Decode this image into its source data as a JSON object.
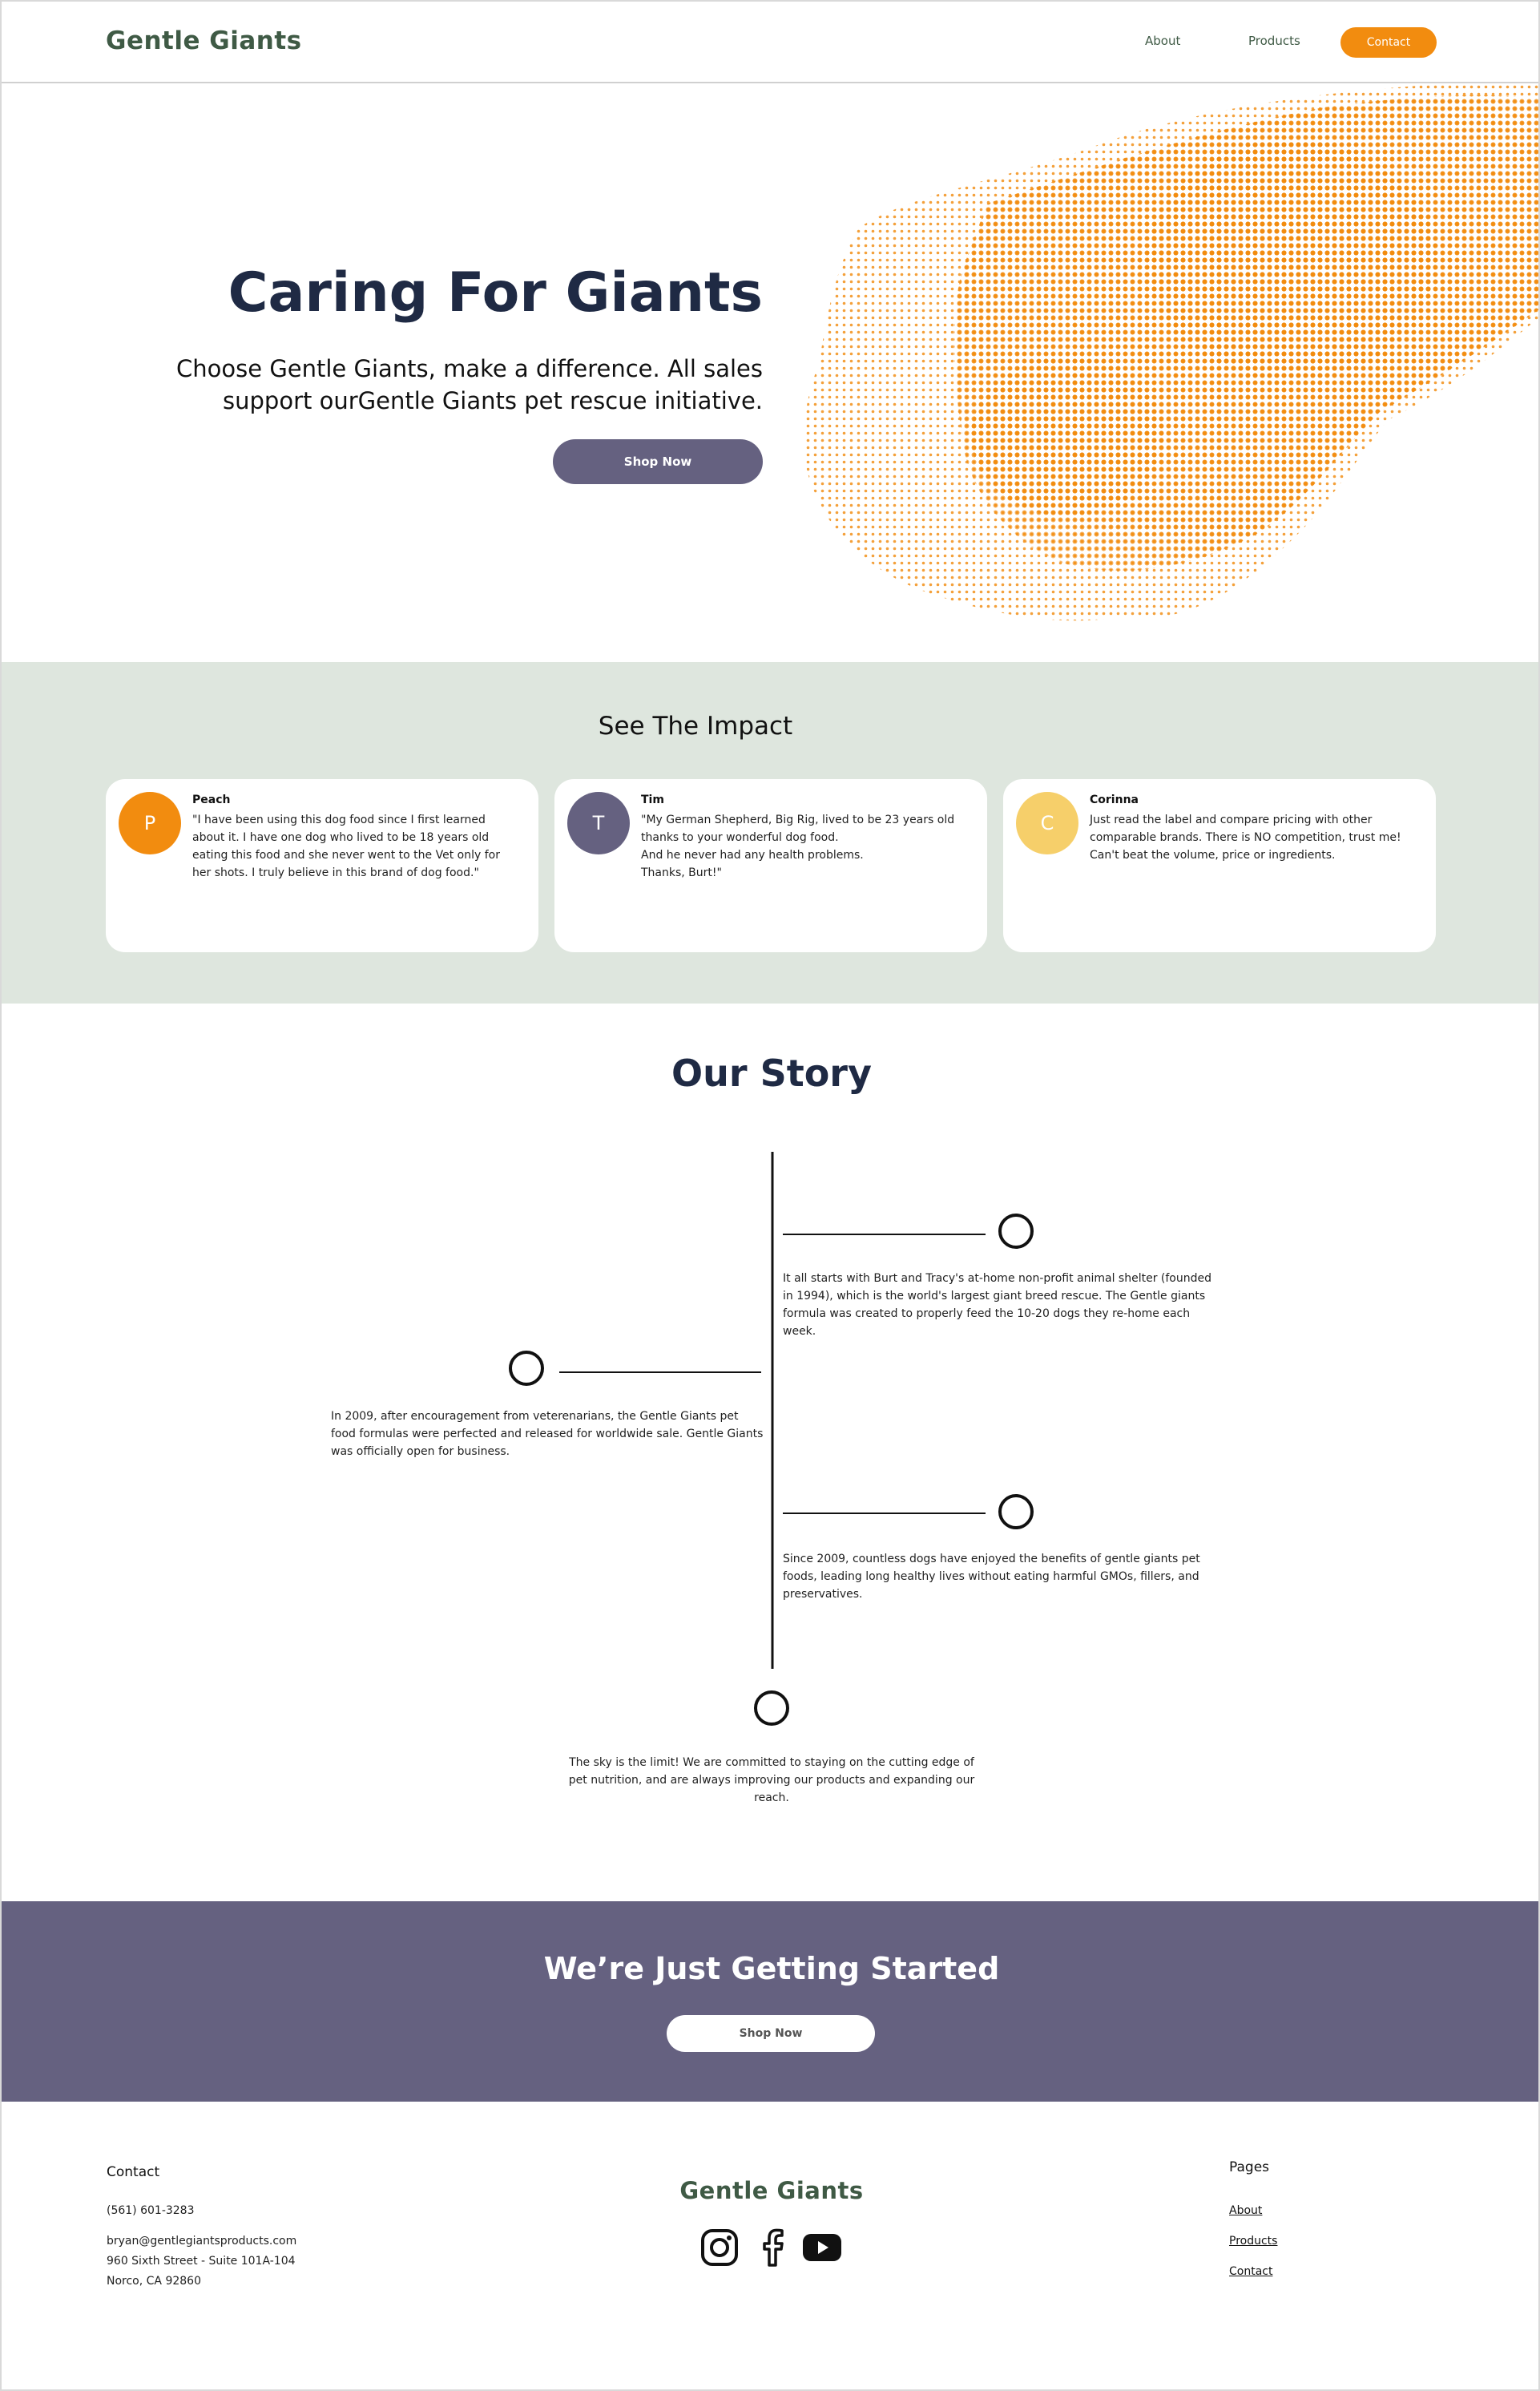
{
  "header": {
    "brand": "Gentle Giants",
    "nav": {
      "about": "About",
      "products": "Products",
      "contact": "Contact"
    }
  },
  "hero": {
    "title": "Caring For Giants",
    "subtitle": "Choose Gentle Giants, make a difference. All sales support ourGentle Giants pet rescue initiative.",
    "button": "Shop Now"
  },
  "impact": {
    "title": "See The Impact",
    "testimonials": [
      {
        "initial": "P",
        "name": "Peach",
        "color": "#f28c0f",
        "text": "\"I have been using this dog food since I first learned about it. I have one dog who lived to be 18 years old eating this food and she never went to the Vet only for her shots. I truly believe in this brand of dog food.\""
      },
      {
        "initial": "T",
        "name": "Tim",
        "color": "#656180",
        "text": "\"My German Shepherd, Big Rig, lived to be 23 years old thanks to your wonderful dog food.\nAnd he never had any health problems.\nThanks, Burt!\""
      },
      {
        "initial": "C",
        "name": "Corinna",
        "color": "#f6cf6a",
        "text": "Just read the label and compare pricing with other comparable brands. There is NO competition, trust me! Can't beat the volume, price or ingredients."
      }
    ]
  },
  "story": {
    "title": "Our Story",
    "entries": [
      "It all starts with Burt and Tracy's at-home non-profit animal shelter (founded in 1994), which is the world's largest giant breed rescue. The Gentle giants formula was created to properly feed the 10-20 dogs they re-home each week.",
      "In 2009, after encouragement from veterenarians, the Gentle Giants pet food formulas were perfected and released for worldwide sale. Gentle Giants was officially open for business.",
      "Since 2009, countless dogs have enjoyed the benefits of gentle giants pet foods,  leading long healthy lives without eating harmful GMOs, fillers, and preservatives.",
      "The sky is the limit! We are committed to staying on the cutting edge of pet nutrition, and are always improving our products and expanding our reach."
    ]
  },
  "cta": {
    "title": "We’re Just Getting Started",
    "button": "Shop Now"
  },
  "footer": {
    "contact_title": "Contact",
    "phone": "(561) 601-3283",
    "email": "bryan@gentlegiantsproducts.com",
    "address_line1": "960 Sixth Street - Suite 101A-104",
    "address_line2": "Norco, CA 92860",
    "brand": "Gentle Giants",
    "social_icons": [
      "instagram-icon",
      "facebook-icon",
      "youtube-icon"
    ],
    "pages_title": "Pages",
    "pages": [
      "About",
      "Products",
      "Contact"
    ]
  },
  "colors": {
    "accent": "#f28c0f",
    "purple": "#656180",
    "sage": "#dee6de",
    "brand_green": "#3f5a45",
    "navy": "#1f2a44"
  }
}
